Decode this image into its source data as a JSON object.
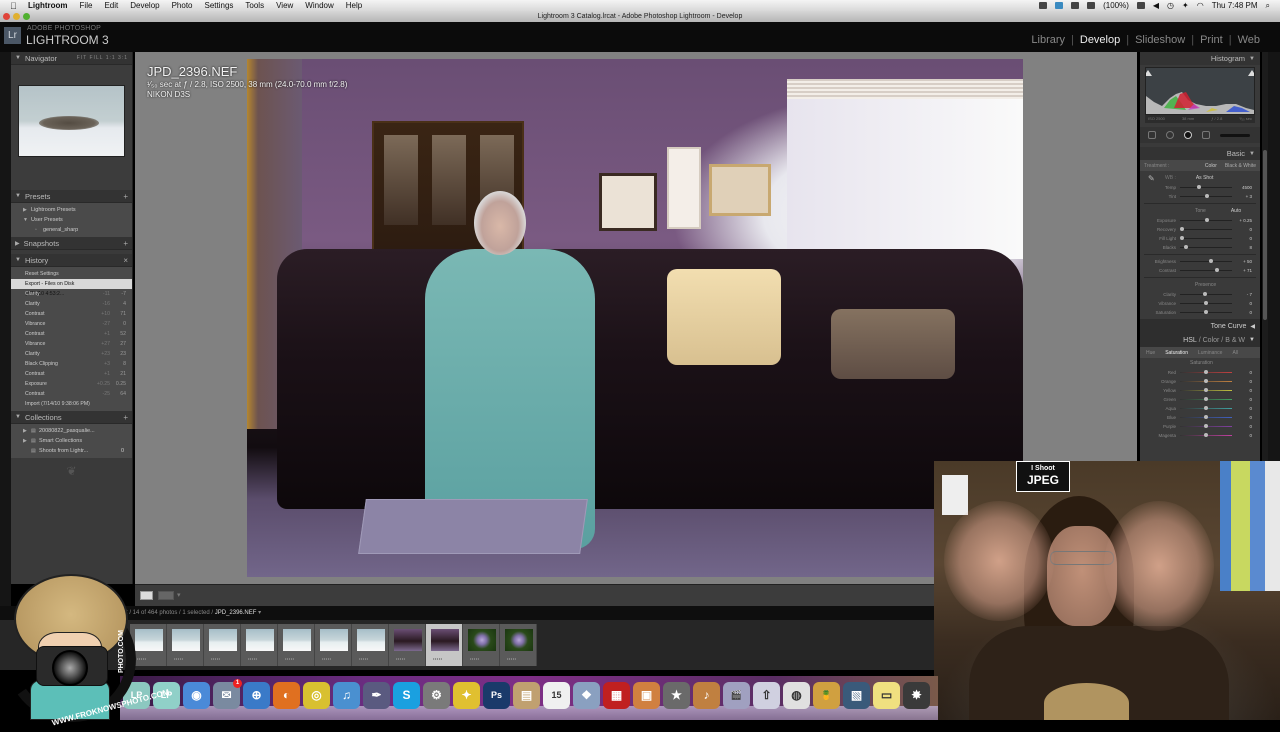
{
  "mac_menubar": {
    "apple_icon": "apple-icon",
    "items": [
      "Lightroom",
      "File",
      "Edit",
      "Develop",
      "Photo",
      "Settings",
      "Tools",
      "View",
      "Window",
      "Help"
    ],
    "battery": "(100%)",
    "clock": "Thu 7:48 PM"
  },
  "window": {
    "title": "Lightroom 3 Catalog.lrcat - Adobe Photoshop Lightroom - Develop"
  },
  "app": {
    "logo_text": "Lr",
    "brand_small": "ADOBE PHOTOSHOP",
    "brand": "LIGHTROOM 3",
    "modules": [
      "Library",
      "Develop",
      "Slideshow",
      "Print",
      "Web"
    ],
    "active_module": "Develop"
  },
  "left_panel": {
    "navigator": {
      "title": "Navigator",
      "zoom_options": "FIT  FILL  1:1  3:1"
    },
    "presets": {
      "title": "Presets",
      "items": [
        {
          "label": "Lightroom Presets",
          "level": 1
        },
        {
          "label": "User Presets",
          "level": 1
        },
        {
          "label": "general_sharp",
          "level": 2
        }
      ]
    },
    "snapshots": {
      "title": "Snapshots"
    },
    "history": {
      "title": "History",
      "items": [
        {
          "label": "Reset Settings",
          "v1": "",
          "v2": ""
        },
        {
          "label": "Export - Files on Disk (7/15/10 4:53:2...",
          "v1": "",
          "v2": "",
          "selected": true
        },
        {
          "label": "Clarity",
          "v1": "-11",
          "v2": "-7"
        },
        {
          "label": "Clarity",
          "v1": "-16",
          "v2": "4"
        },
        {
          "label": "Contrast",
          "v1": "+10",
          "v2": "71"
        },
        {
          "label": "Vibrance",
          "v1": "-27",
          "v2": "0"
        },
        {
          "label": "Contrast",
          "v1": "+1",
          "v2": "52"
        },
        {
          "label": "Vibrance",
          "v1": "+27",
          "v2": "27"
        },
        {
          "label": "Clarity",
          "v1": "+23",
          "v2": "23"
        },
        {
          "label": "Black Clipping",
          "v1": "+3",
          "v2": "8"
        },
        {
          "label": "Contrast",
          "v1": "+1",
          "v2": "21"
        },
        {
          "label": "Exposure",
          "v1": "+0.25",
          "v2": "0.25"
        },
        {
          "label": "Contrast",
          "v1": "-25",
          "v2": "64"
        },
        {
          "label": "Import (7/14/10 9:38:06 PM)",
          "v1": "",
          "v2": ""
        }
      ]
    },
    "collections": {
      "title": "Collections",
      "items": [
        {
          "label": "20080822_pasqualie...",
          "count": ""
        },
        {
          "label": "Smart Collections",
          "count": ""
        },
        {
          "label": "Shoots from Lightr...",
          "count": "0"
        }
      ]
    }
  },
  "photo": {
    "filename": "JPD_2396.NEF",
    "exposure_info": "¹⁄₅₀ sec at ƒ / 2.8, ISO 2500, 38 mm (24.0-70.0 mm f/2.8)",
    "camera": "NIKON D3S"
  },
  "filmstrip": {
    "path": "t / 14 of 464 photos / 1 selected / ",
    "selected_file": "JPD_2396.NEF",
    "thumbnails": [
      {
        "type": "cat",
        "selected": false
      },
      {
        "type": "cat",
        "selected": false
      },
      {
        "type": "cat",
        "selected": false
      },
      {
        "type": "cat",
        "selected": false
      },
      {
        "type": "cat",
        "selected": false
      },
      {
        "type": "cat",
        "selected": false
      },
      {
        "type": "cat",
        "selected": false
      },
      {
        "type": "room",
        "selected": false
      },
      {
        "type": "room",
        "selected": true
      },
      {
        "type": "flower",
        "selected": false
      },
      {
        "type": "flower",
        "selected": false
      }
    ],
    "stars": "•••••"
  },
  "right_panel": {
    "histogram": {
      "title": "Histogram",
      "info": [
        "ISO 2500",
        "38 mm",
        "ƒ / 2.8",
        "¹⁄₅₀ sec"
      ]
    },
    "basic": {
      "title": "Basic",
      "treatment_label": "Treatment :",
      "treatment_options": [
        "Color",
        "Black & White"
      ],
      "wb_label": "WB :",
      "wb_value": "As Shot",
      "wb_sliders": [
        {
          "label": "Temp",
          "value": "4500",
          "pos": 0.35
        },
        {
          "label": "Tint",
          "value": "+ 3",
          "pos": 0.52
        }
      ],
      "tone_label": "Tone",
      "auto_label": "Auto",
      "tone_sliders": [
        {
          "label": "Exposure",
          "value": "+ 0.25",
          "pos": 0.53
        },
        {
          "label": "Recovery",
          "value": "0",
          "pos": 0.0
        },
        {
          "label": "Fill Light",
          "value": "0",
          "pos": 0.0
        },
        {
          "label": "Blacks",
          "value": "8",
          "pos": 0.08
        }
      ],
      "bc_sliders": [
        {
          "label": "Brightness",
          "value": "+ 50",
          "pos": 0.6
        },
        {
          "label": "Contrast",
          "value": "+ 71",
          "pos": 0.72
        }
      ],
      "presence_label": "Presence",
      "presence_sliders": [
        {
          "label": "Clarity",
          "value": "- 7",
          "pos": 0.47
        },
        {
          "label": "Vibrance",
          "value": "0",
          "pos": 0.5
        },
        {
          "label": "Saturation",
          "value": "0",
          "pos": 0.5
        }
      ]
    },
    "tone_curve": {
      "title": "Tone Curve"
    },
    "hsl": {
      "title_parts": [
        "HSL",
        "Color",
        "B & W"
      ],
      "tabs": [
        "Hue",
        "Saturation",
        "Luminance",
        "All"
      ],
      "active_tab": "Saturation",
      "section_label": "Saturation",
      "sliders": [
        {
          "label": "Red",
          "value": "0",
          "color": "#c04040"
        },
        {
          "label": "Orange",
          "value": "0",
          "color": "#c08040"
        },
        {
          "label": "Yellow",
          "value": "0",
          "color": "#c0c040"
        },
        {
          "label": "Green",
          "value": "0",
          "color": "#40a060"
        },
        {
          "label": "Aqua",
          "value": "0",
          "color": "#40a0a0"
        },
        {
          "label": "Blue",
          "value": "0",
          "color": "#4060c0"
        },
        {
          "label": "Purple",
          "value": "0",
          "color": "#8040a0"
        },
        {
          "label": "Magenta",
          "value": "0",
          "color": "#c040a0"
        }
      ]
    }
  },
  "overlays": {
    "mascot_url": "WWW.FROKNOWSPHOTO.COM",
    "mascot_url_vert": "PHOTO.COM",
    "webcam_sign_top": "I Shoot",
    "webcam_sign_big": "JPEG"
  },
  "dock": {
    "icons": [
      {
        "name": "lp1",
        "color": "#8cc8c0",
        "glyph": "LP"
      },
      {
        "name": "lp2",
        "color": "#90d0c8",
        "glyph": "LP"
      },
      {
        "name": "ichat",
        "color": "#4a8ad8",
        "glyph": "◉"
      },
      {
        "name": "mail",
        "color": "#7a8aa0",
        "glyph": "✉",
        "badge": "1"
      },
      {
        "name": "safari",
        "color": "#3a7ac8",
        "glyph": "⊕"
      },
      {
        "name": "firefox",
        "color": "#e07020",
        "glyph": "◐"
      },
      {
        "name": "chrome",
        "color": "#d8c030",
        "glyph": "◎"
      },
      {
        "name": "itunes",
        "color": "#4a90d0",
        "glyph": "♫"
      },
      {
        "name": "quill",
        "color": "#5a5a80",
        "glyph": "✒"
      },
      {
        "name": "skype",
        "color": "#1aa0e0",
        "glyph": "S"
      },
      {
        "name": "utility",
        "color": "#7a7a7a",
        "glyph": "⚙"
      },
      {
        "name": "twitter-bird",
        "color": "#e0c030",
        "glyph": "✦"
      },
      {
        "name": "photoshop",
        "color": "#1a3a6a",
        "glyph": "Ps"
      },
      {
        "name": "notebook",
        "color": "#c0a070",
        "glyph": "▤"
      },
      {
        "name": "ical",
        "color": "#f0f0f0",
        "glyph": "15"
      },
      {
        "name": "iphoto",
        "color": "#8aa0c0",
        "glyph": "❖"
      },
      {
        "name": "dvd",
        "color": "#c02020",
        "glyph": "▦"
      },
      {
        "name": "iphoto2",
        "color": "#d08040",
        "glyph": "▣"
      },
      {
        "name": "imovie",
        "color": "#6a6a6a",
        "glyph": "★"
      },
      {
        "name": "garageband",
        "color": "#c08040",
        "glyph": "♪"
      },
      {
        "name": "idvd",
        "color": "#a0a0c0",
        "glyph": "🎬"
      },
      {
        "name": "flickr",
        "color": "#d0d0e0",
        "glyph": "⇧"
      },
      {
        "name": "preview",
        "color": "#e0e0e0",
        "glyph": "◍"
      },
      {
        "name": "cocktail",
        "color": "#d0a040",
        "glyph": "🍍"
      },
      {
        "name": "finalcut",
        "color": "#3a5a7a",
        "glyph": "▧"
      },
      {
        "name": "stickies",
        "color": "#f0e080",
        "glyph": "▭"
      },
      {
        "name": "aperture",
        "color": "#3a3a3a",
        "glyph": "✸"
      }
    ]
  }
}
